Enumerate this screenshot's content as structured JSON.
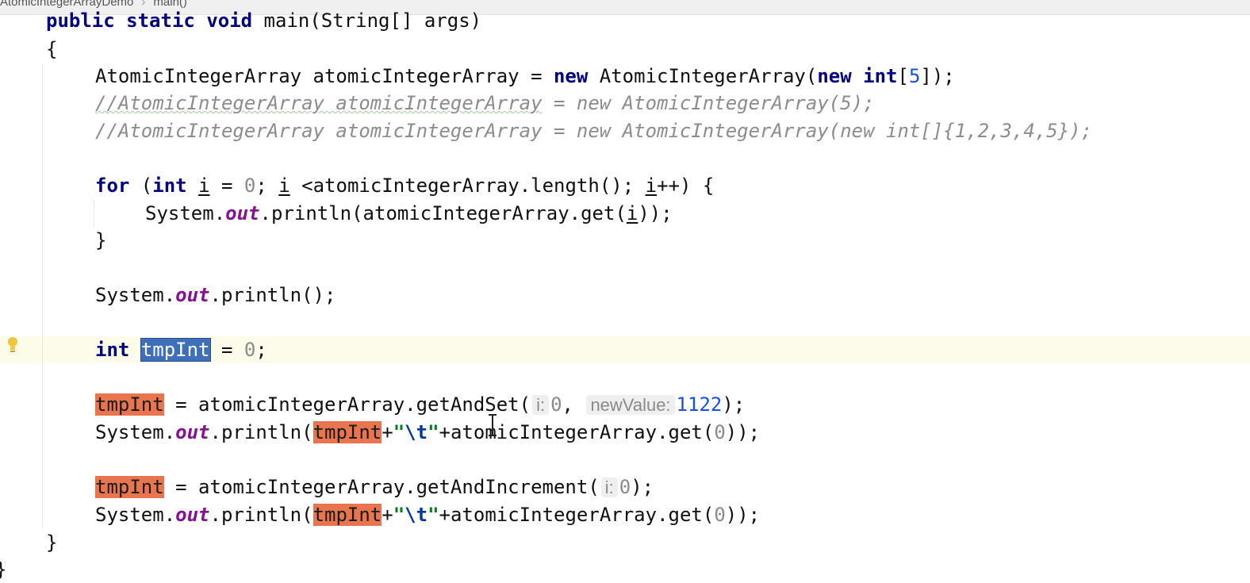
{
  "breadcrumb": {
    "file": "AtomicIntegerArrayDemo",
    "separator": "›",
    "method": "main()"
  },
  "editor": {
    "caret_line_number": 13,
    "gutter_icons": [
      "intention-bulb-icon"
    ]
  },
  "code": {
    "l1": {
      "kw1": "public",
      "kw2": "static",
      "kw3": "void",
      "rest": " main(String[] args)"
    },
    "l2": {
      "text": "{"
    },
    "l3": {
      "a": "AtomicIntegerArray atomicIntegerArray = ",
      "kw_new1": "new",
      "b": " AtomicIntegerArray(",
      "kw_new2": "new",
      "kw_int": "int",
      "c": "[",
      "n5": "5",
      "d": "]);"
    },
    "l4": {
      "squig": "//AtomicIntegerArray atomicIntegerArray",
      "rest": " = new AtomicIntegerArray(5);"
    },
    "l5": {
      "text": "//AtomicIntegerArray atomicIntegerArray = new AtomicIntegerArray(new int[]{1,2,3,4,5});"
    },
    "l7": {
      "kw_for": "for",
      "a": " (",
      "kw_int": "int",
      "sp": " ",
      "i1": "i",
      "b": " = ",
      "n0": "0",
      "c": "; ",
      "i2": "i",
      "d": " <atomicIntegerArray.length(); ",
      "i3": "i",
      "e": "++) {"
    },
    "l8": {
      "a": "System.",
      "out": "out",
      "b": ".println(atomicIntegerArray.get(",
      "i": "i",
      "c": "));"
    },
    "l9": {
      "text": "}"
    },
    "l11": {
      "a": "System.",
      "out": "out",
      "b": ".println();"
    },
    "l13": {
      "kw_int": "int",
      "sp": " ",
      "var": "tmpInt",
      "b": " = ",
      "n0": "0",
      "c": ";"
    },
    "l15": {
      "var": "tmpInt",
      "a": " = atomicIntegerArray.getAndSet(",
      "hint_i": "i:",
      "n0": "0",
      "b": ", ",
      "hint_nv": "newValue:",
      "n1122": "1122",
      "c": ");"
    },
    "l16": {
      "a": "System.",
      "out": "out",
      "b": ".println(",
      "var": "tmpInt",
      "c": "+",
      "q1": "\"",
      "esc": "\\t",
      "q2": "\"",
      "d": "+atomicIntegerArray.get(",
      "n0": "0",
      "e": "));"
    },
    "l18": {
      "var": "tmpInt",
      "a": " = atomicIntegerArray.getAndIncrement(",
      "hint_i": "i:",
      "n0": "0",
      "b": ");"
    },
    "l19": {
      "a": "System.",
      "out": "out",
      "b": ".println(",
      "var": "tmpInt",
      "c": "+",
      "q1": "\"",
      "esc": "\\t",
      "q2": "\"",
      "d": "+atomicIntegerArray.get(",
      "n0": "0",
      "e": "));"
    },
    "l20": {
      "text": "}"
    },
    "l21": {
      "text": "}"
    }
  },
  "colors": {
    "keyword": "#000080",
    "number": "#1750eb",
    "comment": "#8c8c8c",
    "static_field": "#871094",
    "selection": "#3d6fba",
    "occurrence_highlight": "#e8754e",
    "caret_row": "#fdfbe9",
    "string": "#067d17"
  }
}
